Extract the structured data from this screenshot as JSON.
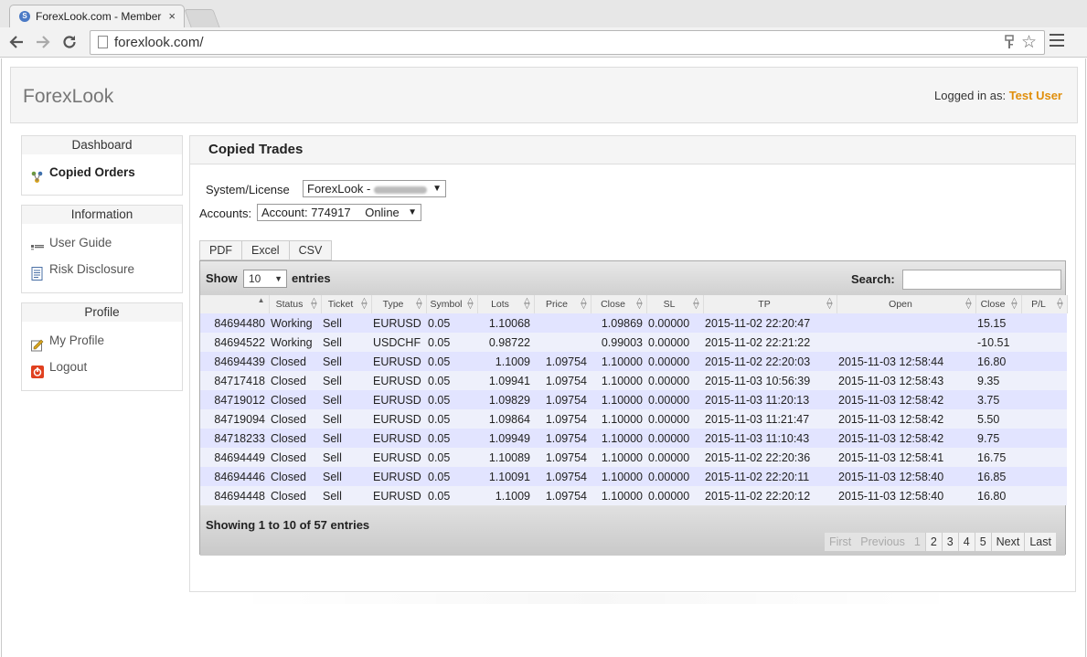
{
  "browser": {
    "tab_title": "ForexLook.com - Member A",
    "tab_close": "×",
    "url": "forexlook.com/"
  },
  "header": {
    "brand": "ForexLook",
    "logged_label": "Logged in as:",
    "user_name": "Test User"
  },
  "sidebar": {
    "dashboard": {
      "title": "Dashboard",
      "items": [
        {
          "label": "Copied Orders",
          "icon": "copied-orders-icon"
        }
      ]
    },
    "information": {
      "title": "Information",
      "items": [
        {
          "label": "User Guide",
          "icon": "user-guide-icon"
        },
        {
          "label": "Risk Disclosure",
          "icon": "document-icon"
        }
      ]
    },
    "profile": {
      "title": "Profile",
      "items": [
        {
          "label": "My Profile",
          "icon": "edit-profile-icon"
        },
        {
          "label": "Logout",
          "icon": "power-icon"
        }
      ]
    }
  },
  "main": {
    "title": "Copied Trades",
    "system_label": "System/License",
    "system_value": "ForexLook -",
    "accounts_label": "Accounts:",
    "account_value": "Account: 774917",
    "account_status": "Online",
    "export_buttons": [
      "PDF",
      "Excel",
      "CSV"
    ],
    "table": {
      "show_label": "Show",
      "length_value": "10",
      "entries_label": "entries",
      "search_label": "Search:",
      "search_value": "",
      "columns": [
        "",
        "Status",
        "Ticket",
        "Type",
        "Symbol",
        "Lots",
        "Price",
        "Close",
        "SL",
        "TP",
        "Open",
        "Close",
        "P/L"
      ],
      "rows": [
        [
          "84694480",
          "Working",
          "Sell",
          "EURUSD",
          "0.05",
          "1.10068",
          "",
          "1.09869",
          "0.00000",
          "2015-11-02 22:20:47",
          "",
          "15.15"
        ],
        [
          "84694522",
          "Working",
          "Sell",
          "USDCHF",
          "0.05",
          "0.98722",
          "",
          "0.99003",
          "0.00000",
          "2015-11-02 22:21:22",
          "",
          "-10.51"
        ],
        [
          "84694439",
          "Closed",
          "Sell",
          "EURUSD",
          "0.05",
          "1.1009",
          "1.09754",
          "1.10000",
          "0.00000",
          "2015-11-02 22:20:03",
          "2015-11-03 12:58:44",
          "16.80"
        ],
        [
          "84717418",
          "Closed",
          "Sell",
          "EURUSD",
          "0.05",
          "1.09941",
          "1.09754",
          "1.10000",
          "0.00000",
          "2015-11-03 10:56:39",
          "2015-11-03 12:58:43",
          "9.35"
        ],
        [
          "84719012",
          "Closed",
          "Sell",
          "EURUSD",
          "0.05",
          "1.09829",
          "1.09754",
          "1.10000",
          "0.00000",
          "2015-11-03 11:20:13",
          "2015-11-03 12:58:42",
          "3.75"
        ],
        [
          "84719094",
          "Closed",
          "Sell",
          "EURUSD",
          "0.05",
          "1.09864",
          "1.09754",
          "1.10000",
          "0.00000",
          "2015-11-03 11:21:47",
          "2015-11-03 12:58:42",
          "5.50"
        ],
        [
          "84718233",
          "Closed",
          "Sell",
          "EURUSD",
          "0.05",
          "1.09949",
          "1.09754",
          "1.10000",
          "0.00000",
          "2015-11-03 11:10:43",
          "2015-11-03 12:58:42",
          "9.75"
        ],
        [
          "84694449",
          "Closed",
          "Sell",
          "EURUSD",
          "0.05",
          "1.10089",
          "1.09754",
          "1.10000",
          "0.00000",
          "2015-11-02 22:20:36",
          "2015-11-03 12:58:41",
          "16.75"
        ],
        [
          "84694446",
          "Closed",
          "Sell",
          "EURUSD",
          "0.05",
          "1.10091",
          "1.09754",
          "1.10000",
          "0.00000",
          "2015-11-02 22:20:11",
          "2015-11-03 12:58:40",
          "16.85"
        ],
        [
          "84694448",
          "Closed",
          "Sell",
          "EURUSD",
          "0.05",
          "1.1009",
          "1.09754",
          "1.10000",
          "0.00000",
          "2015-11-02 22:20:12",
          "2015-11-03 12:58:40",
          "16.80"
        ]
      ],
      "info": "Showing 1 to 10 of 57 entries",
      "pagination": {
        "first": "First",
        "previous": "Previous",
        "pages": [
          "1",
          "2",
          "3",
          "4",
          "5"
        ],
        "next": "Next",
        "last": "Last"
      }
    }
  },
  "colors": {
    "user_name": "#e08e0b",
    "row_odd": "#e2e4ff",
    "row_even": "#eef0fb"
  }
}
